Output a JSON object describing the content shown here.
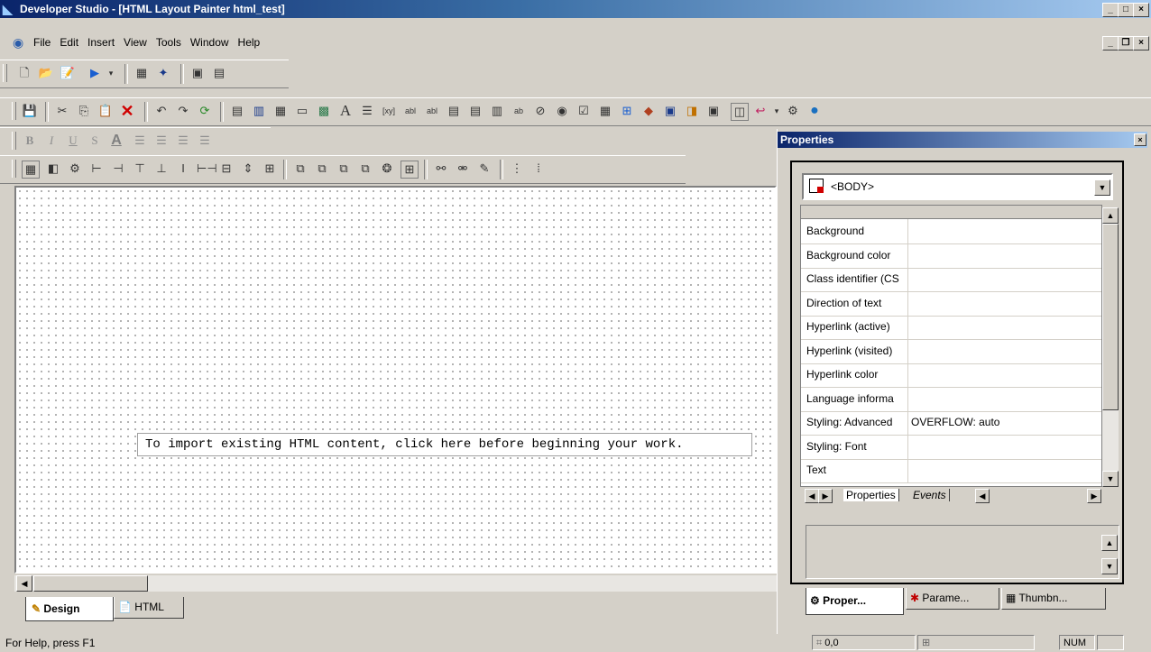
{
  "window": {
    "title": "Developer Studio - [HTML Layout Painter html_test]"
  },
  "menu": {
    "items": [
      "File",
      "Edit",
      "Insert",
      "View",
      "Tools",
      "Window",
      "Help"
    ]
  },
  "canvas": {
    "import_hint": "To import existing HTML content, click here before beginning your work."
  },
  "editor_tabs": {
    "design": "Design",
    "html": "HTML"
  },
  "status": {
    "help": "For Help, press F1",
    "coords": "0,0",
    "num": "NUM"
  },
  "properties": {
    "title": "Properties",
    "selected_element": "<BODY>",
    "rows": [
      {
        "name": "Background",
        "value": ""
      },
      {
        "name": "Background color",
        "value": ""
      },
      {
        "name": "Class identifier (CS",
        "value": ""
      },
      {
        "name": "Direction of text",
        "value": ""
      },
      {
        "name": "Hyperlink (active)",
        "value": ""
      },
      {
        "name": "Hyperlink (visited)",
        "value": ""
      },
      {
        "name": "Hyperlink color",
        "value": ""
      },
      {
        "name": "Language informa",
        "value": ""
      },
      {
        "name": "Styling: Advanced",
        "value": "OVERFLOW: auto"
      },
      {
        "name": "Styling: Font",
        "value": ""
      },
      {
        "name": "Text",
        "value": ""
      }
    ],
    "inner_tabs": [
      "Properties",
      "Events"
    ],
    "bottom_tabs": [
      "Proper...",
      "Parame...",
      "Thumbn..."
    ]
  }
}
